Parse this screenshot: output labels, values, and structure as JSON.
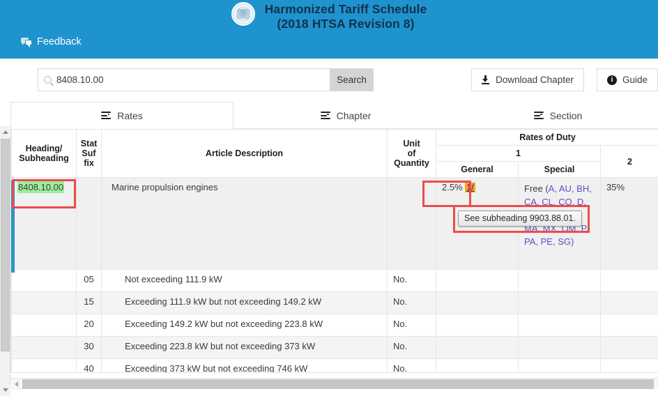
{
  "banner": {
    "seal_icon": "us-seal-icon",
    "title_line1": "Harmonized Tariff Schedule",
    "title_line2": "(2018 HTSA Revision 8)",
    "feedback_label": "Feedback",
    "feedback_icon": "speech-bubble-icon",
    "background_color": "#1f93ce"
  },
  "toolbar": {
    "search_icon": "search-icon",
    "search_value": "8408.10.00",
    "search_placeholder": "Search",
    "search_button_label": "Search",
    "download_icon": "download-icon",
    "download_label": "Download Chapter",
    "guide_icon": "info-circle-icon",
    "guide_label": "Guide"
  },
  "tabs": [
    {
      "label": "Rates",
      "icon": "list-lines-icon",
      "active": true
    },
    {
      "label": "Chapter",
      "icon": "list-lines-icon",
      "active": false
    },
    {
      "label": "Section",
      "icon": "list-lines-icon",
      "active": false
    }
  ],
  "table": {
    "headers": {
      "heading": "Heading/",
      "heading2": "Subheading",
      "stat1": "Stat",
      "stat2": "Suf",
      "stat3": "fix",
      "article": "Article Description",
      "unit1": "Unit",
      "unit2": "of",
      "unit3": "Quantity",
      "rates_of_duty": "Rates of Duty",
      "col1": "1",
      "general": "General",
      "special": "Special",
      "col2": "2"
    },
    "rows": [
      {
        "code": "8408.10.00",
        "code_highlighted": true,
        "stat": "",
        "description": "Marine propulsion engines",
        "unit": "",
        "general": "2.5%",
        "general_footnote": "1/",
        "special_label": "Free (",
        "special_lines": [
          "A, AU,",
          "BH, CA, CL,",
          "CO, D, E, IL,",
          "JO, KR, MA,",
          "MX, OM, P, PA,",
          "PE, SG)"
        ],
        "col2": "35%"
      },
      {
        "code": "",
        "stat": "05",
        "description": "Not exceeding 111.9 kW",
        "unit": "No.",
        "general": "",
        "special_lines": [],
        "col2": ""
      },
      {
        "code": "",
        "stat": "15",
        "description": "Exceeding 111.9 kW but not exceeding 149.2 kW",
        "unit": "No.",
        "general": "",
        "special_lines": [],
        "col2": ""
      },
      {
        "code": "",
        "stat": "20",
        "description": "Exceeding 149.2 kW but not exceeding 223.8 kW",
        "unit": "No.",
        "general": "",
        "special_lines": [],
        "col2": ""
      },
      {
        "code": "",
        "stat": "30",
        "description": "Exceeding 223.8 kW but not exceeding 373 kW",
        "unit": "No.",
        "general": "",
        "special_lines": [],
        "col2": ""
      },
      {
        "code": "",
        "stat": "40",
        "description": "Exceeding 373 kW but not exceeding 746 kW",
        "unit": "No.",
        "general": "",
        "special_lines": [],
        "col2": ""
      }
    ]
  },
  "tooltip": {
    "text": "See subheading 9903.88.01."
  },
  "annotations": {
    "highlight_color": "#ee4b4b",
    "code_highlight_color": "#9bf09b",
    "footnote_highlight_color": "#f5a623"
  },
  "scrollbars": {
    "vertical_up_icon": "triangle-up-icon",
    "vertical_down_icon": "triangle-down-icon",
    "horizontal_left_icon": "triangle-left-icon"
  }
}
